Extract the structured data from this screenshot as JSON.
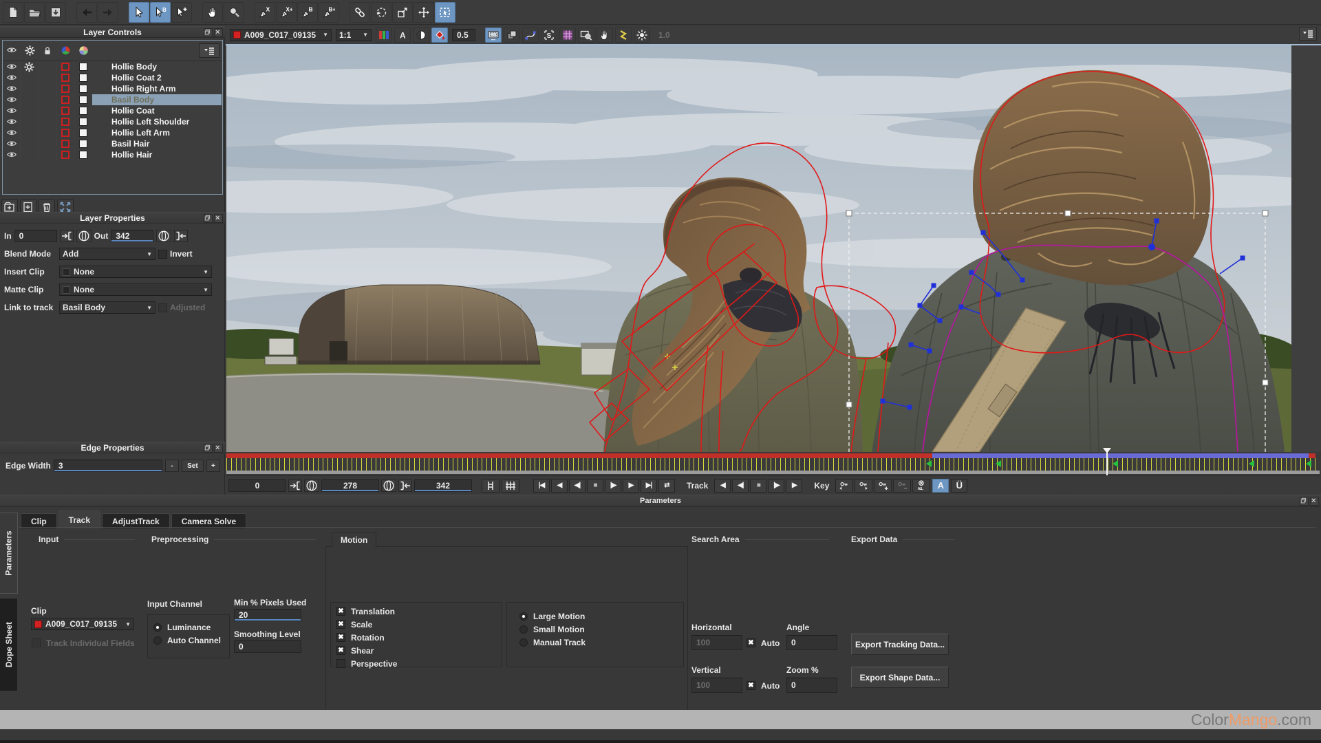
{
  "top_toolbar": {
    "groups": [
      [
        {
          "icon": "new-file"
        },
        {
          "icon": "open-project"
        },
        {
          "icon": "save-project"
        }
      ],
      [
        {
          "icon": "back-arrow"
        },
        {
          "icon": "forward-arrow"
        }
      ],
      [
        {
          "icon": "select-tool",
          "active": true
        },
        {
          "icon": "select-bezier-tool",
          "active": true
        },
        {
          "icon": "add-point-tool"
        }
      ],
      [
        {
          "icon": "pan-tool"
        },
        {
          "icon": "zoom-tool"
        }
      ],
      [
        {
          "icon": "create-xspline-tool"
        },
        {
          "icon": "add-xspline-tool"
        },
        {
          "icon": "create-bspline-tool"
        },
        {
          "icon": "add-bspline-tool"
        }
      ],
      [
        {
          "icon": "link-tool"
        },
        {
          "icon": "lasso-tool"
        },
        {
          "icon": "corner-pin-tool"
        },
        {
          "icon": "move-tool"
        },
        {
          "icon": "marquee-select-tool",
          "active": true
        }
      ]
    ]
  },
  "viewer_toolbar": {
    "clip_name": "A009_C017_09135",
    "zoom_level": "1:1",
    "overlay_alpha": "0.5",
    "gain_value": "1.0",
    "icons_left": [
      {
        "icon": "rgb-channels"
      },
      {
        "icon": "alpha-channel"
      },
      {
        "icon": "contrast-view"
      },
      {
        "icon": "overlay-fill",
        "active": true
      }
    ],
    "icons_right": [
      {
        "icon": "surface-view",
        "active": true
      },
      {
        "icon": "layers-view"
      },
      {
        "icon": "spline-view"
      },
      {
        "icon": "stabilize-view"
      },
      {
        "icon": "grid-view"
      },
      {
        "icon": "zoom-window"
      },
      {
        "icon": "pan-view"
      },
      {
        "icon": "trace-view"
      },
      {
        "icon": "brightness-view"
      }
    ]
  },
  "layer_controls": {
    "title": "Layer Controls",
    "header_icons": [
      "eye",
      "gear",
      "lock",
      "roto-sphere",
      "color-sphere"
    ],
    "layers": [
      {
        "name": "Hollie Body",
        "gear": true
      },
      {
        "name": "Hollie Coat 2"
      },
      {
        "name": "Hollie Right Arm"
      },
      {
        "name": "Basil Body",
        "selected": true
      },
      {
        "name": "Hollie Coat"
      },
      {
        "name": "Hollie Left Shoulder"
      },
      {
        "name": "Hollie Left Arm"
      },
      {
        "name": "Basil Hair"
      },
      {
        "name": "Hollie Hair"
      }
    ],
    "footer_icons": [
      "new-group",
      "new-layer",
      "delete-layer",
      "expand"
    ]
  },
  "layer_properties": {
    "title": "Layer Properties",
    "in_label": "In",
    "in_value": "0",
    "out_label": "Out",
    "out_value": "342",
    "blend_mode_label": "Blend Mode",
    "blend_mode_value": "Add",
    "invert_label": "Invert",
    "insert_clip_label": "Insert Clip",
    "insert_clip_value": "None",
    "matte_clip_label": "Matte Clip",
    "matte_clip_value": "None",
    "link_label": "Link to track",
    "link_value": "Basil Body",
    "adjusted_label": "Adjusted"
  },
  "edge_properties": {
    "title": "Edge Properties",
    "width_label": "Edge Width",
    "width_value": "3",
    "dec_label": "-",
    "set_label": "Set",
    "inc_label": "+"
  },
  "timeline": {
    "in_value": "0",
    "current_frame": "278",
    "out_value": "342",
    "total_frames": 342,
    "tracked_until_frame": 223,
    "keyframe_frames": [
      222,
      244,
      281,
      324,
      342
    ],
    "track_label": "Track",
    "key_label": "Key",
    "autokey_label": "A",
    "uberkey_label": "Ü",
    "transport_icons": [
      "goto-start",
      "play-back",
      "step-back",
      "stop",
      "step-fwd",
      "play-fwd",
      "goto-end",
      "loop"
    ],
    "track_icons": [
      "track-bwd-all",
      "track-bwd",
      "track-stop",
      "track-fwd",
      "track-fwd-all"
    ],
    "key_icons": [
      "key-prev",
      "key-next",
      "key-add",
      "key-del",
      "key-all"
    ]
  },
  "parameters": {
    "strip_title": "Parameters",
    "side_tabs": [
      {
        "label": "Parameters",
        "active": true
      },
      {
        "label": "Dope Sheet",
        "active": false
      }
    ],
    "tabs": [
      {
        "label": "Clip"
      },
      {
        "label": "Track",
        "active": true
      },
      {
        "label": "AdjustTrack"
      },
      {
        "label": "Camera Solve"
      }
    ],
    "input": {
      "group_label": "Input",
      "clip_label": "Clip",
      "clip_value": "A009_C017_09135",
      "track_fields_label": "Track Individual Fields"
    },
    "preprocessing": {
      "group_label": "Preprocessing",
      "input_channel_label": "Input Channel",
      "channels": [
        {
          "label": "Luminance",
          "selected": true
        },
        {
          "label": "Auto Channel",
          "selected": false
        }
      ],
      "min_pixels_label": "Min % Pixels Used",
      "min_pixels_value": "20",
      "smoothing_label": "Smoothing Level",
      "smoothing_value": "0"
    },
    "motion": {
      "group_label": "Motion",
      "checkboxes": [
        {
          "label": "Translation",
          "checked": true
        },
        {
          "label": "Scale",
          "checked": true
        },
        {
          "label": "Rotation",
          "checked": true
        },
        {
          "label": "Shear",
          "checked": true
        },
        {
          "label": "Perspective",
          "checked": false
        }
      ],
      "modes": [
        {
          "label": "Large Motion",
          "selected": true
        },
        {
          "label": "Small Motion",
          "selected": false
        },
        {
          "label": "Manual Track",
          "selected": false
        }
      ]
    },
    "search_area": {
      "group_label": "Search Area",
      "horizontal_label": "Horizontal",
      "horizontal_value": "100",
      "vertical_label": "Vertical",
      "vertical_value": "100",
      "auto_label": "Auto",
      "angle_label": "Angle",
      "angle_value": "0",
      "zoom_label": "Zoom %",
      "zoom_value": "0"
    },
    "export_data": {
      "group_label": "Export Data",
      "buttons": [
        {
          "label": "Export Tracking Data..."
        },
        {
          "label": "Export Shape Data..."
        }
      ]
    }
  },
  "watermark": {
    "gray": "Color",
    "orange": "Mango",
    "suffix": ".com"
  }
}
